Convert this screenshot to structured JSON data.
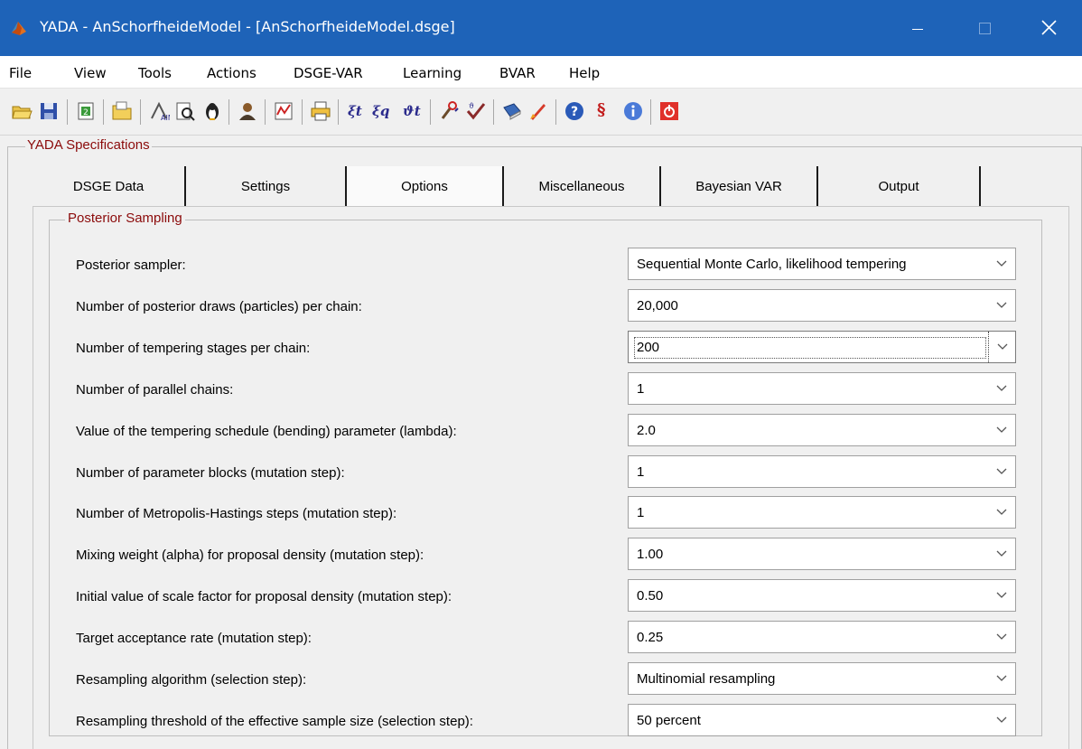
{
  "window": {
    "title": "YADA - AnSchorfheideModel - [AnSchorfheideModel.dsge]",
    "icon": "matlab-icon",
    "controls": [
      "minimize-icon",
      "maximize-icon",
      "close-icon"
    ]
  },
  "menu": [
    "File",
    "View",
    "Tools",
    "Actions",
    "DSGE-VAR",
    "Learning",
    "BVAR",
    "Help"
  ],
  "toolbar": {
    "icons": [
      "open-folder-icon",
      "save-icon",
      "refresh-icon",
      "folder-icon",
      "aim-icon",
      "document-search-icon",
      "penguin-icon",
      "user-icon",
      "chart-icon",
      "print-icon",
      "xi-t-label",
      "xi-q-label",
      "theta-t-label",
      "wrench-icon",
      "check-tool-icon",
      "book-icon",
      "rocket-icon",
      "help-icon",
      "section-icon",
      "info-icon",
      "power-icon"
    ],
    "glyphs": {
      "xi_t": "ξt",
      "xi_q": "ξq",
      "theta_t": "ϑt",
      "section": "§"
    }
  },
  "specifications_label": "YADA Specifications",
  "tabs": [
    {
      "label": "DSGE Data",
      "active": false
    },
    {
      "label": "Settings",
      "active": false
    },
    {
      "label": "Options",
      "active": true
    },
    {
      "label": "Miscellaneous",
      "active": false
    },
    {
      "label": "Bayesian VAR",
      "active": false
    },
    {
      "label": "Output",
      "active": false
    }
  ],
  "posterior": {
    "label": "Posterior Sampling",
    "rows": [
      {
        "label": "Posterior sampler:",
        "value": "Sequential Monte Carlo, likelihood tempering"
      },
      {
        "label": "Number of posterior draws (particles) per chain:",
        "value": "20,000"
      },
      {
        "label": "Number of tempering stages per chain:",
        "value": "200"
      },
      {
        "label": "Number of parallel chains:",
        "value": "1"
      },
      {
        "label": "Value of the tempering schedule (bending) parameter (lambda):",
        "value": "2.0"
      },
      {
        "label": "Number of parameter blocks (mutation step):",
        "value": "1"
      },
      {
        "label": "Number of Metropolis-Hastings steps (mutation step):",
        "value": "1"
      },
      {
        "label": "Mixing weight (alpha) for proposal density (mutation step):",
        "value": "1.00"
      },
      {
        "label": "Initial value of scale factor for proposal density (mutation step):",
        "value": "0.50"
      },
      {
        "label": "Target acceptance rate (mutation step):",
        "value": "0.25"
      },
      {
        "label": "Resampling algorithm (selection step):",
        "value": "Multinomial resampling"
      },
      {
        "label": "Resampling threshold of the effective sample size (selection step):",
        "value": "50 percent"
      }
    ]
  },
  "colors": {
    "titlebar": "#1e63b8",
    "group_label": "#8b0a0a"
  }
}
